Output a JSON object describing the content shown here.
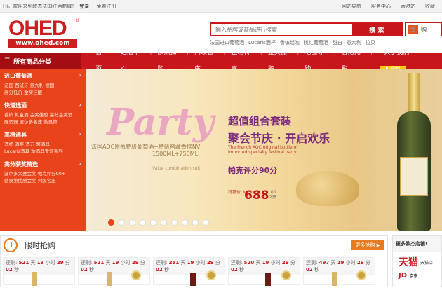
{
  "topbar": {
    "welcome": "Hi，欢迎来到欧杰法国红酒商城！",
    "login": "登录",
    "register": "免费注册",
    "links": [
      "网站导航",
      "服务中心",
      "香港站",
      "收藏"
    ]
  },
  "logo": {
    "text": "OHED",
    "reg": "®",
    "url": "www.ohed.com"
  },
  "search": {
    "placeholder": "输入品牌或商品进行搜索",
    "button": "搜 索",
    "hotwords": [
      "法国进口葡萄酒",
      "Lucaris酒杯",
      "香槟起泡",
      "桃红葡萄酒",
      "甜白",
      "意大利",
      "拉贝"
    ]
  },
  "cart": {
    "label": "购"
  },
  "nav": {
    "category": "所有商品分类",
    "items": [
      "首页",
      "选酒中心",
      "欧杰独购",
      "列级名庄",
      "整箱特惠",
      "金奖品鉴",
      "地图导购",
      "香港免税",
      "关于我们"
    ],
    "new_badge": "NEW"
  },
  "sidebar": [
    {
      "title": "进口葡萄酒",
      "links": [
        "法国 西班牙 意大利 德国",
        "高分低价 金奖佳酿"
      ]
    },
    {
      "title": "快速选酒",
      "links": [
        "香槟 礼盒酒 金奖佳酿 高分金奖酒",
        "醒酒器 波尔多名庄 勃艮第"
      ]
    },
    {
      "title": "高档酒具",
      "links": [
        "酒杯 酒柜 酒刀 醒酒器",
        "Lucaris酒具 劝酒器专营系列"
      ]
    },
    {
      "title": "高分获奖精选",
      "links": [
        "波尔多大赛金奖 帕克评分90+",
        "勃艮第优质金奖 列级名庄"
      ]
    }
  ],
  "banner": {
    "party": "Party",
    "en_line": "法国AOC原瓶特级葡萄酒+特级窖藏香槟NV",
    "sub": "1500ML+750ML",
    "value_label": "Value combination suit",
    "title1": "超值组合套装",
    "title2": "聚会节庆 · 开启欢乐",
    "en_desc": "The French AOC original bottle of imported specialty festival party",
    "score": "帕克评分90分",
    "price_label": "特惠价 >>>>",
    "price": "688",
    "price_cents": ".00",
    "price_unit": "2支",
    "dots": 10,
    "active_dot": 0
  },
  "flash": {
    "title": "限时抢购",
    "more": "更多抢购 ▶",
    "cards": [
      {
        "prefix": "还剩:",
        "d": "521",
        "h": "19",
        "m": "29",
        "s": "02"
      },
      {
        "prefix": "还剩:",
        "d": "521",
        "h": "19",
        "m": "29",
        "s": "02"
      },
      {
        "prefix": "还剩:",
        "d": "281",
        "h": "19",
        "m": "29",
        "s": "02"
      },
      {
        "prefix": "还剩:",
        "d": "520",
        "h": "19",
        "m": "29",
        "s": "02"
      },
      {
        "prefix": "还剩:",
        "d": "497",
        "h": "19",
        "m": "29",
        "s": "02"
      }
    ],
    "units": {
      "d": "天",
      "h": "小时",
      "m": "分",
      "s": "秒"
    }
  },
  "rside": {
    "title": "更多欧杰店铺!",
    "tmall": "天猫",
    "tmall_sub": "天猫店",
    "jd": "JD",
    "jd_sub": "京东"
  },
  "colors": {
    "brand_red": "#c8161d",
    "sidebar_orange": "#e8431b",
    "accent_orange": "#e87a1f"
  }
}
